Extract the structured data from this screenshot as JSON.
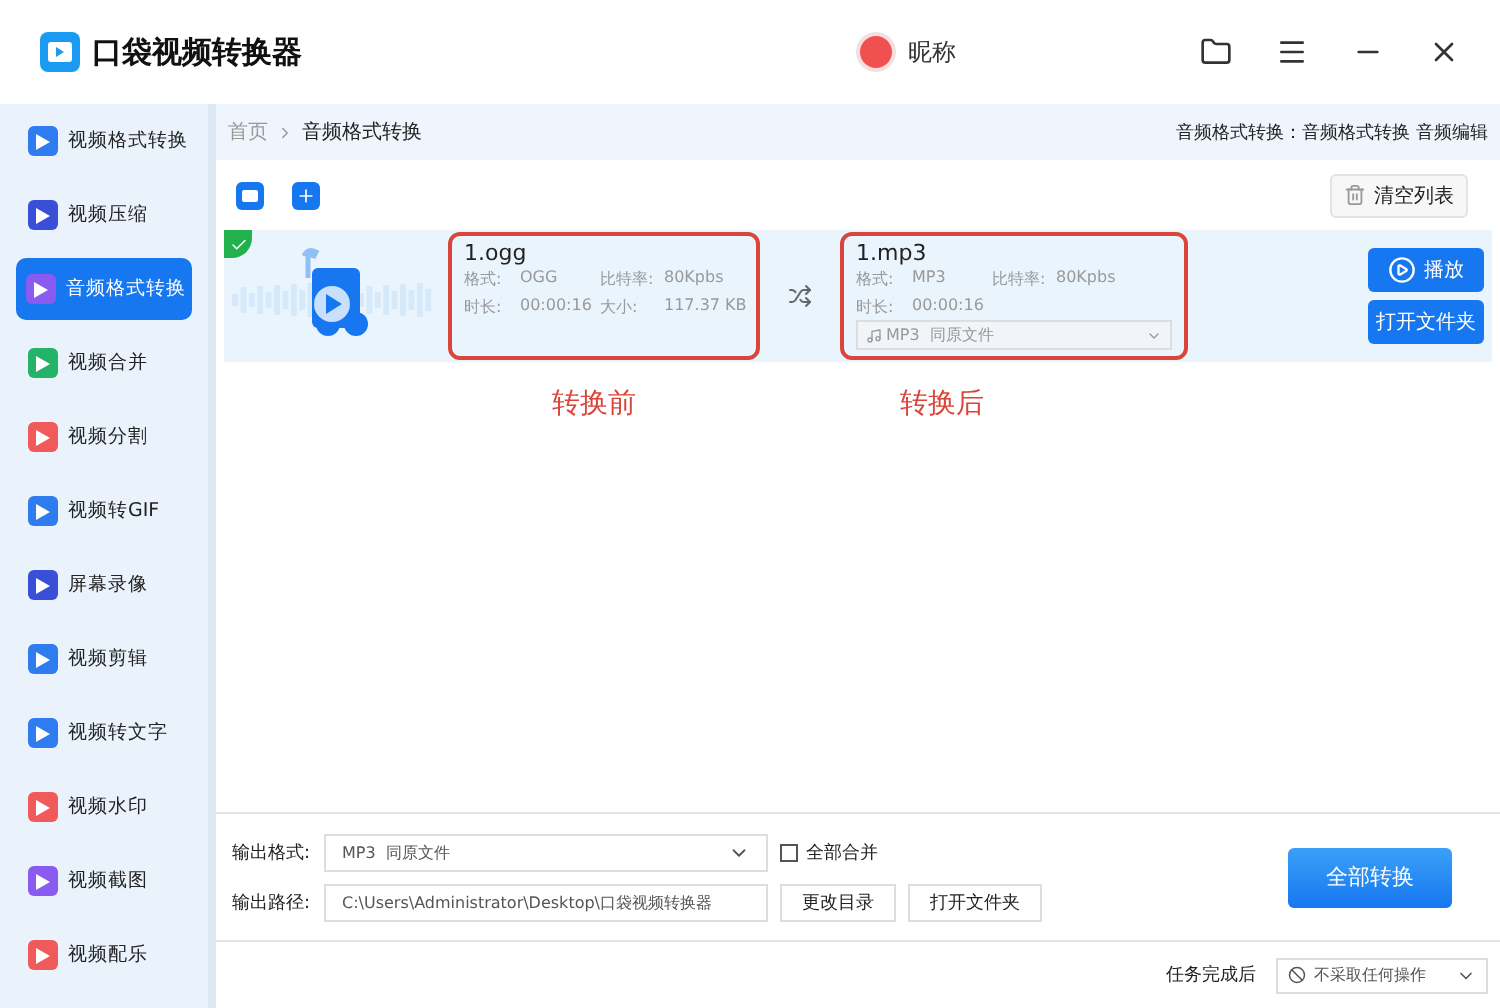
{
  "app": {
    "title": "口袋视频转换器",
    "nickname": "昵称"
  },
  "sidebar": {
    "items": [
      {
        "label": "视频格式转换",
        "selected": false,
        "color": "#2f7bf0"
      },
      {
        "label": "视频压缩",
        "selected": false,
        "color": "#3a4fd8"
      },
      {
        "label": "音频格式转换",
        "selected": true,
        "color": "#8a5bf0"
      },
      {
        "label": "视频合并",
        "selected": false,
        "color": "#25b36a"
      },
      {
        "label": "视频分割",
        "selected": false,
        "color": "#f05a5a"
      },
      {
        "label": "视频转GIF",
        "selected": false,
        "color": "#2f7bf0"
      },
      {
        "label": "屏幕录像",
        "selected": false,
        "color": "#3a4fd8"
      },
      {
        "label": "视频剪辑",
        "selected": false,
        "color": "#2f7bf0"
      },
      {
        "label": "视频转文字",
        "selected": false,
        "color": "#2f7bf0"
      },
      {
        "label": "视频水印",
        "selected": false,
        "color": "#f05a5a"
      },
      {
        "label": "视频截图",
        "selected": false,
        "color": "#8a5bf0"
      },
      {
        "label": "视频配乐",
        "selected": false,
        "color": "#f05a5a"
      }
    ]
  },
  "breadcrumb": {
    "home": "首页",
    "current": "音频格式转换",
    "right": "音频格式转换：音频格式转换 音频编辑"
  },
  "clear_button": "清空列表",
  "file": {
    "checked": true,
    "source": {
      "name": "1.ogg",
      "format_label": "格式:",
      "format": "OGG",
      "bitrate_label": "比特率:",
      "bitrate": "80Kpbs",
      "duration_label": "时长:",
      "duration": "00:00:16",
      "size_label": "大小:",
      "size": "117.37 KB"
    },
    "target": {
      "name": "1.mp3",
      "format_label": "格式:",
      "format": "MP3",
      "bitrate_label": "比特率:",
      "bitrate": "80Kpbs",
      "duration_label": "时长:",
      "duration": "00:00:16",
      "select": "MP3  同原文件"
    },
    "play_button": "播放",
    "open_folder_button": "打开文件夹"
  },
  "annotations": [
    "转换前",
    "转换后"
  ],
  "output": {
    "format_label": "输出格式:",
    "format": "MP3  同原文件",
    "merge_label": "全部合并",
    "merge_checked": false,
    "path_label": "输出路径:",
    "path": "C:\\Users\\Administrator\\Desktop\\口袋视频转换器",
    "change_dir_button": "更改目录",
    "open_folder_button": "打开文件夹",
    "convert_all_button": "全部转换"
  },
  "status": {
    "after_label": "任务完成后",
    "after_select": "不采取任何操作"
  }
}
